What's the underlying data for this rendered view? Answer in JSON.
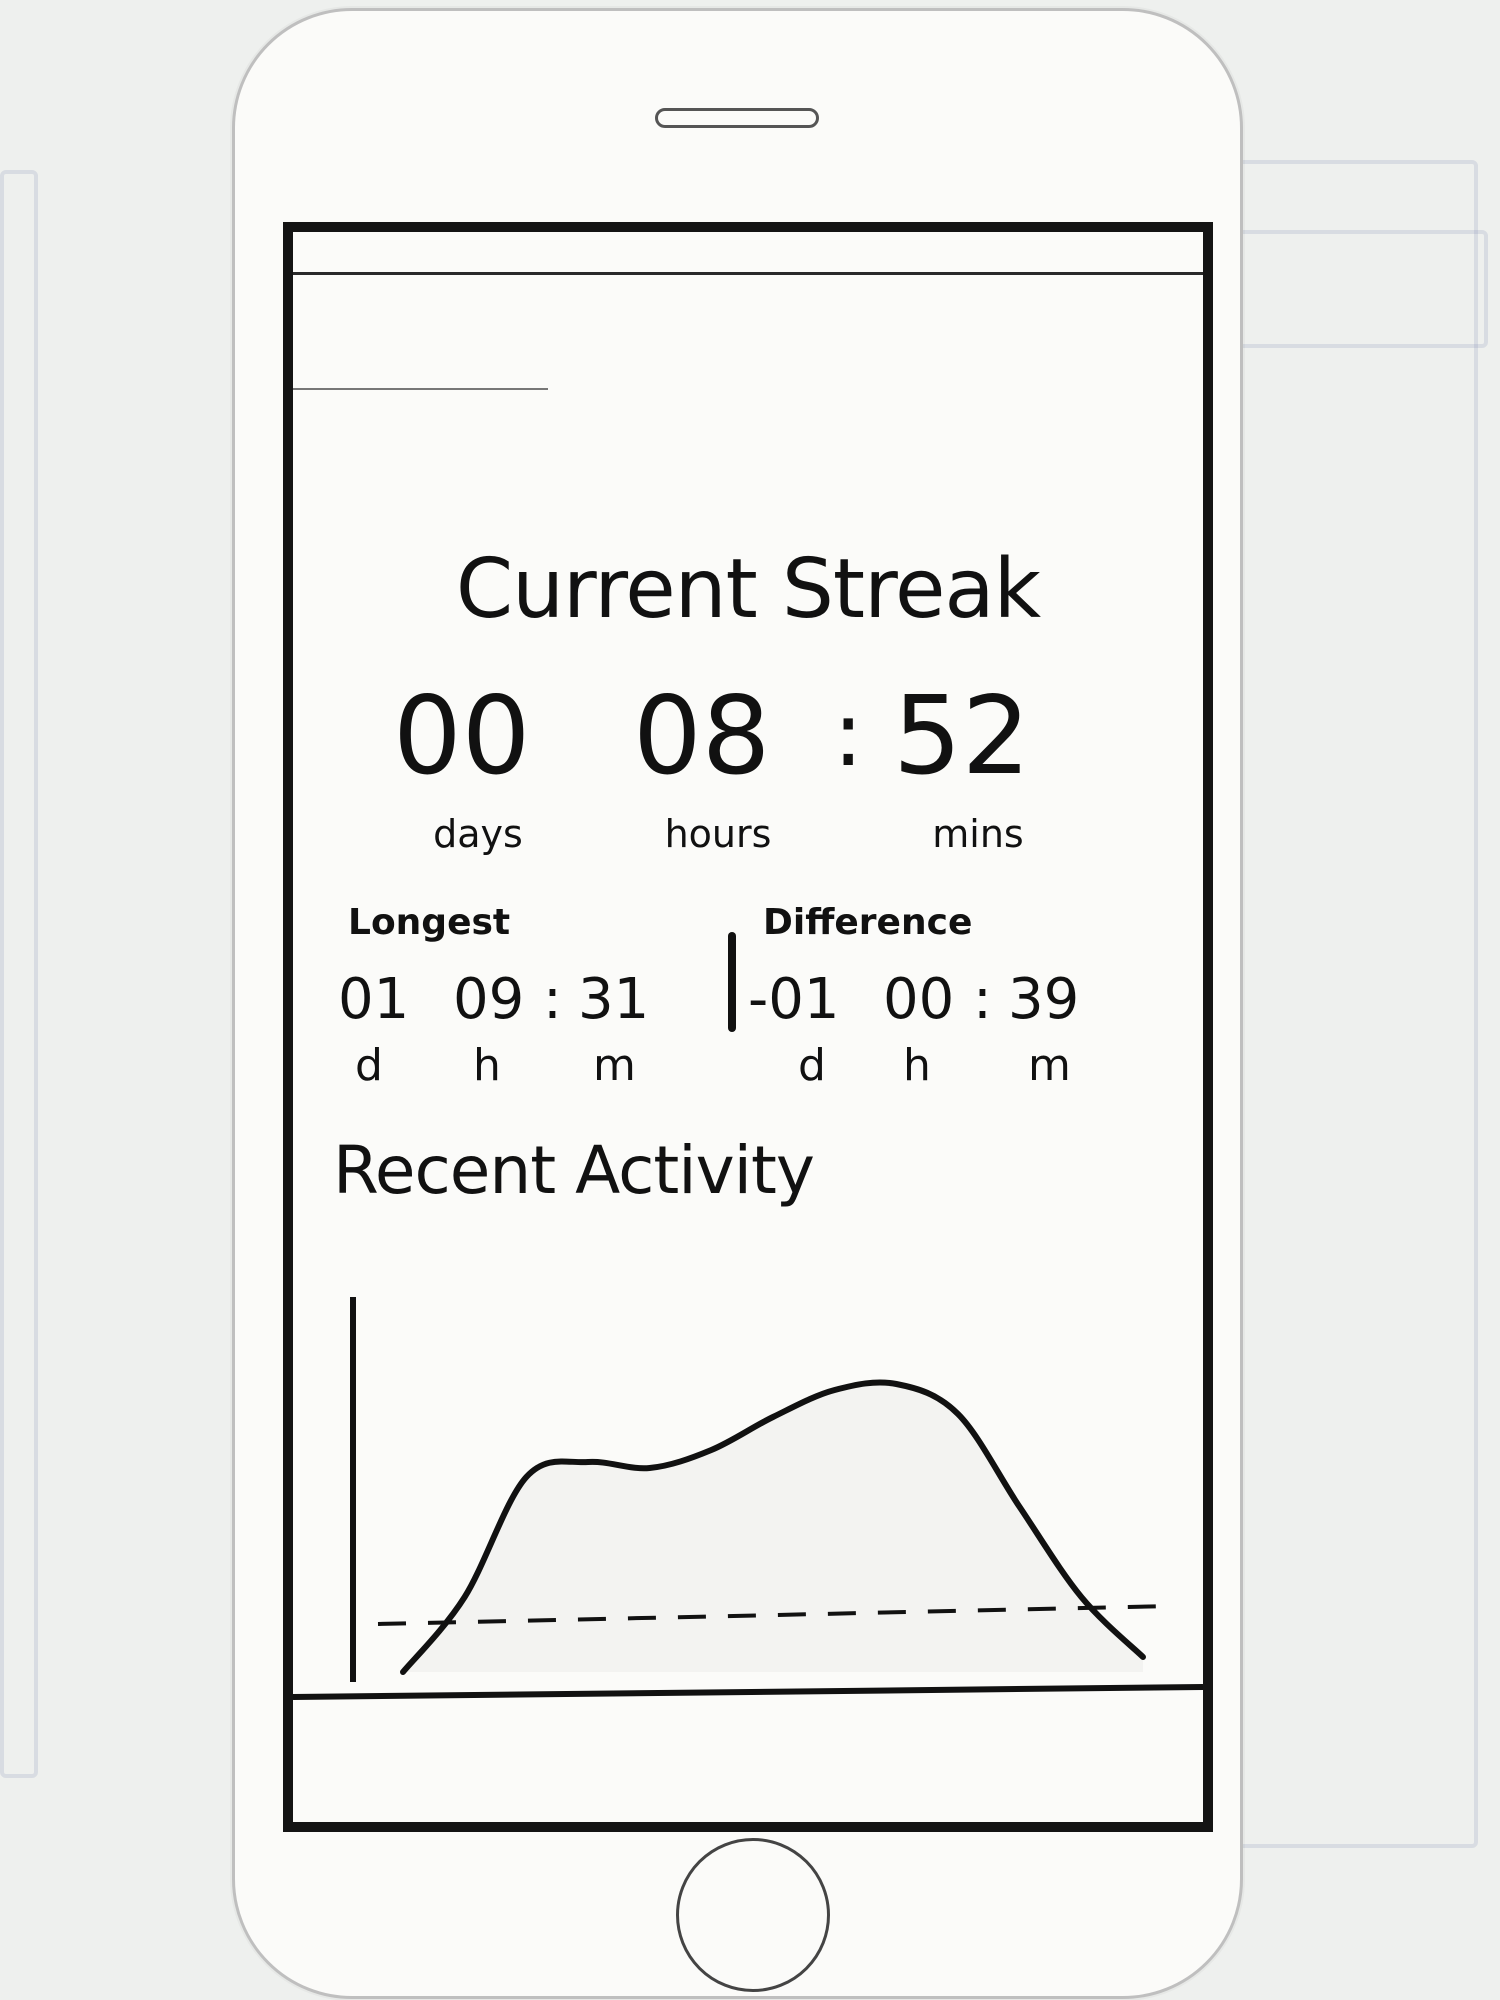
{
  "screen": {
    "title": "Current Streak",
    "current": {
      "days": "00",
      "hours": "08",
      "mins": "52",
      "separator": ":",
      "days_label": "days",
      "hours_label": "hours",
      "mins_label": "mins"
    },
    "longest": {
      "label": "Longest",
      "days": "01",
      "hours": "09",
      "mins": "31",
      "separator": ":",
      "d_label": "d",
      "h_label": "h",
      "m_label": "m"
    },
    "difference": {
      "label": "Difference",
      "days": "-01",
      "hours": "00",
      "mins": "39",
      "separator": ":",
      "d_label": "d",
      "h_label": "h",
      "m_label": "m"
    },
    "recent_activity": {
      "title": "Recent Activity"
    }
  },
  "chart_data": {
    "type": "area",
    "title": "",
    "xlabel": "",
    "ylabel": "",
    "x": [
      0,
      1,
      2,
      3,
      4,
      5,
      6,
      7,
      8,
      9,
      10,
      11,
      12
    ],
    "values": [
      0,
      2.5,
      6.5,
      7,
      6.8,
      7.4,
      8.5,
      9.4,
      9.6,
      8.6,
      5.5,
      2.5,
      0.5
    ],
    "reference_line": 1.8,
    "reference_style": "dashed",
    "ylim": [
      0,
      12
    ],
    "grid": false,
    "legend": "none"
  }
}
